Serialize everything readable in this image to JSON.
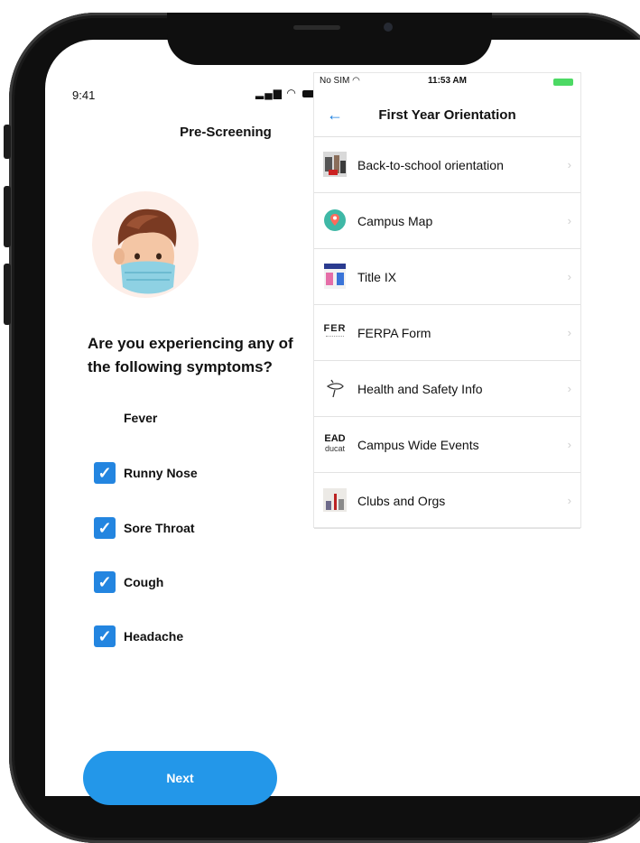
{
  "left_screen": {
    "status_time": "9:41",
    "title": "Pre-Screening",
    "question": "Are you experiencing any of the following symptoms?",
    "symptoms": [
      {
        "label": "Fever",
        "checked": false
      },
      {
        "label": "Runny Nose",
        "checked": true
      },
      {
        "label": "Sore Throat",
        "checked": true
      },
      {
        "label": "Cough",
        "checked": true
      },
      {
        "label": "Headache",
        "checked": true
      }
    ],
    "next_label": "Next"
  },
  "right_panel": {
    "status_carrier": "No SIM",
    "status_time": "11:53 AM",
    "back_icon": "←",
    "title": "First Year Orientation",
    "chevron": "›",
    "items": [
      {
        "label": "Back-to-school orientation",
        "icon": "photo-icon"
      },
      {
        "label": "Campus Map",
        "icon": "map-pin-icon"
      },
      {
        "label": "Title IX",
        "icon": "title-ix-icon"
      },
      {
        "label": "FERPA Form",
        "icon": "ferpa-logo-icon",
        "icon_text": "FER"
      },
      {
        "label": "Health and Safety Info",
        "icon": "cord-icon"
      },
      {
        "label": "Campus Wide Events",
        "icon": "events-logo-icon",
        "icon_text_top": "EAD",
        "icon_text_bottom": "ducat"
      },
      {
        "label": "Clubs and Orgs",
        "icon": "clubs-photo-icon"
      }
    ]
  }
}
